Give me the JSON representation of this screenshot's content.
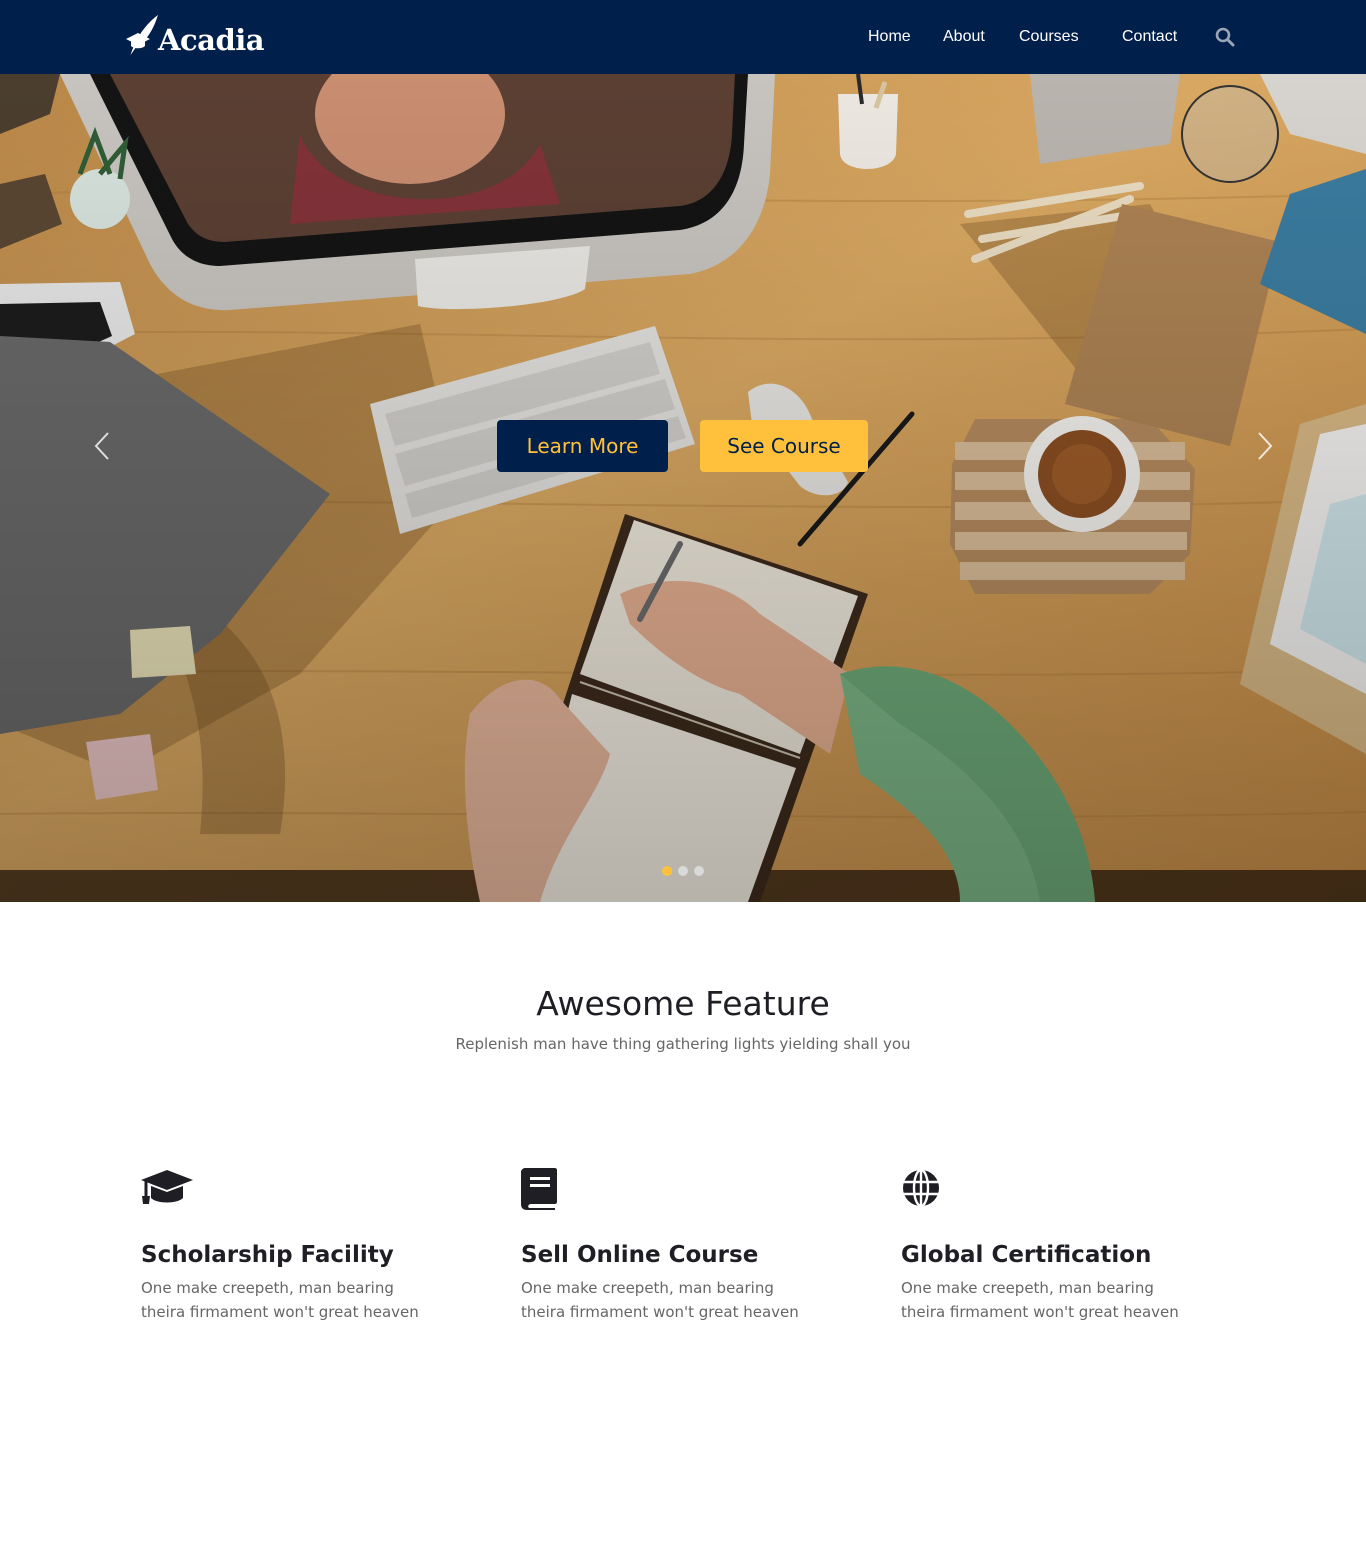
{
  "brand": {
    "name": "Acadia",
    "logo_icon": "feather-graduation-cap-icon"
  },
  "nav": {
    "items": [
      {
        "label": "Home"
      },
      {
        "label": "About"
      },
      {
        "label": "Courses"
      },
      {
        "label": "Contact"
      }
    ],
    "search_icon": "search-icon"
  },
  "hero": {
    "buttons": {
      "learn_more": "Learn More",
      "see_course": "See Course"
    },
    "slides_count": 3,
    "active_slide": 1,
    "arrows": {
      "prev_icon": "chevron-left-icon",
      "next_icon": "chevron-right-icon"
    }
  },
  "features": {
    "title": "Awesome Feature",
    "subtitle": "Replenish man have thing gathering lights yielding shall you",
    "items": [
      {
        "icon": "graduation-cap-icon",
        "title": "Scholarship Facility",
        "text": "One make creepeth, man bearing theira firmament won't great heaven"
      },
      {
        "icon": "book-icon",
        "title": "Sell Online Course",
        "text": "One make creepeth, man bearing theira firmament won't great heaven"
      },
      {
        "icon": "globe-icon",
        "title": "Global Certification",
        "text": "One make creepeth, man bearing theira firmament won't great heaven"
      }
    ]
  },
  "colors": {
    "navy": "#011f4b",
    "accent_yellow": "#ffc13b",
    "text_dark": "#1e1e24",
    "text_muted": "#666666"
  }
}
